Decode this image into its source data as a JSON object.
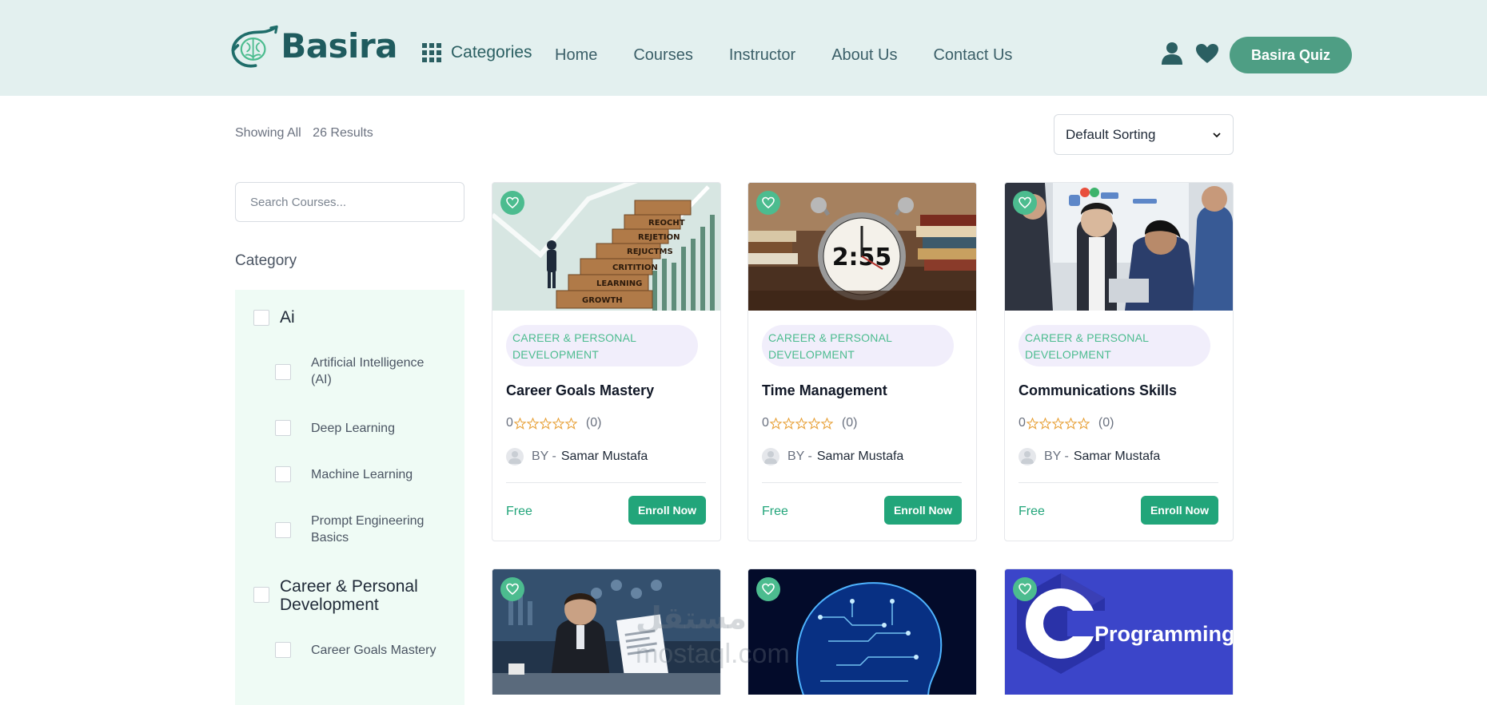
{
  "header": {
    "logo_text": "Basira",
    "categories_label": "Categories",
    "nav": [
      "Home",
      "Courses",
      "Instructor",
      "About Us",
      "Contact Us"
    ],
    "quiz_button": "Basira Quiz"
  },
  "results": {
    "prefix": "Showing All",
    "count": "26 Results"
  },
  "sort": {
    "selected": "Default Sorting"
  },
  "sidebar": {
    "search_placeholder": "Search Courses...",
    "category_title": "Category",
    "groups": [
      {
        "label": "Ai",
        "items": [
          "Artificial Intelligence (AI)",
          "Deep Learning",
          "Machine Learning",
          "Prompt Engineering Basics"
        ]
      },
      {
        "label": "Career & Personal Development",
        "items": [
          "Career Goals Mastery"
        ]
      }
    ]
  },
  "cards": [
    {
      "tag": "CAREER & PERSONAL DEVELOPMENT",
      "title": "Career Goals Mastery",
      "rating": "0",
      "rating_count": "(0)",
      "by": "BY -",
      "author": "Samar Mustafa",
      "price": "Free",
      "enroll": "Enroll Now"
    },
    {
      "tag": "CAREER & PERSONAL DEVELOPMENT",
      "title": "Time Management",
      "rating": "0",
      "rating_count": "(0)",
      "by": "BY -",
      "author": "Samar Mustafa",
      "price": "Free",
      "enroll": "Enroll Now"
    },
    {
      "tag": "CAREER & PERSONAL DEVELOPMENT",
      "title": "Communications Skills",
      "rating": "0",
      "rating_count": "(0)",
      "by": "BY -",
      "author": "Samar Mustafa",
      "price": "Free",
      "enroll": "Enroll Now"
    }
  ],
  "image_texts": {
    "career_steps": [
      "GROWTH",
      "LEARNING",
      "CRITITION",
      "REJUCTMS",
      "REJETION",
      "REOCHT"
    ],
    "clock_digits": "2:55",
    "programming": "Programming",
    "c_letter": "C"
  },
  "watermark": {
    "line1": "مستقل",
    "line2": "mostaql.com"
  },
  "colors": {
    "header_bg": "#e3f0ef",
    "brand": "#1f5b5e",
    "accent": "#22a57a",
    "quiz": "#4e9e84",
    "tag_bg": "#f1eefb",
    "panel_bg": "#effbf5"
  },
  "icons": {
    "logo": "brain-arrow-icon",
    "categories": "grid-icon",
    "user": "user-icon",
    "wishlist": "heart-icon",
    "favorite": "heart-outline-icon",
    "star": "star-outline-icon",
    "sort": "chevron-down-icon"
  }
}
